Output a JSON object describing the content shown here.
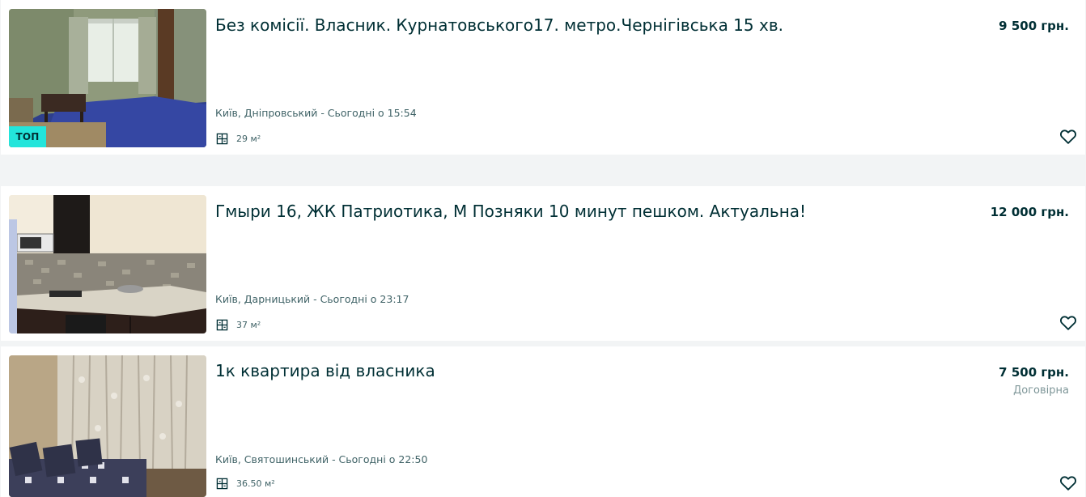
{
  "listings": [
    {
      "title": "Без комісії. Власник. Курнатовського17. метро.Чернігівська 15 хв.",
      "price": "9 500 грн.",
      "location": "Київ, Дніпровський - Сьогодні о 15:54",
      "area": "29 м²",
      "badge": "ТОП",
      "photo": "room-with-blue-carpet"
    },
    {
      "title": "Гмыри 16, ЖК Патриотика, М Позняки 10 минут пешком. Актуальна!",
      "price": "12 000 грн.",
      "location": "Київ, Дарницький - Сьогодні о 23:17",
      "area": "37 м²",
      "photo": "kitchen"
    },
    {
      "title": "1к квартира від власника",
      "price": "7 500 грн.",
      "negotiable": "Договірна",
      "location": "Київ, Святошинський - Сьогодні о 22:50",
      "area": "36.50 м²",
      "photo": "room-with-sofa-and-curtain"
    }
  ],
  "icons": {
    "area": "floor-plan-icon",
    "favorite": "heart-outline-icon"
  },
  "colors": {
    "text": "#002f34",
    "muted": "#406367",
    "badge": "#23e5db",
    "background": "#f2f4f5"
  }
}
